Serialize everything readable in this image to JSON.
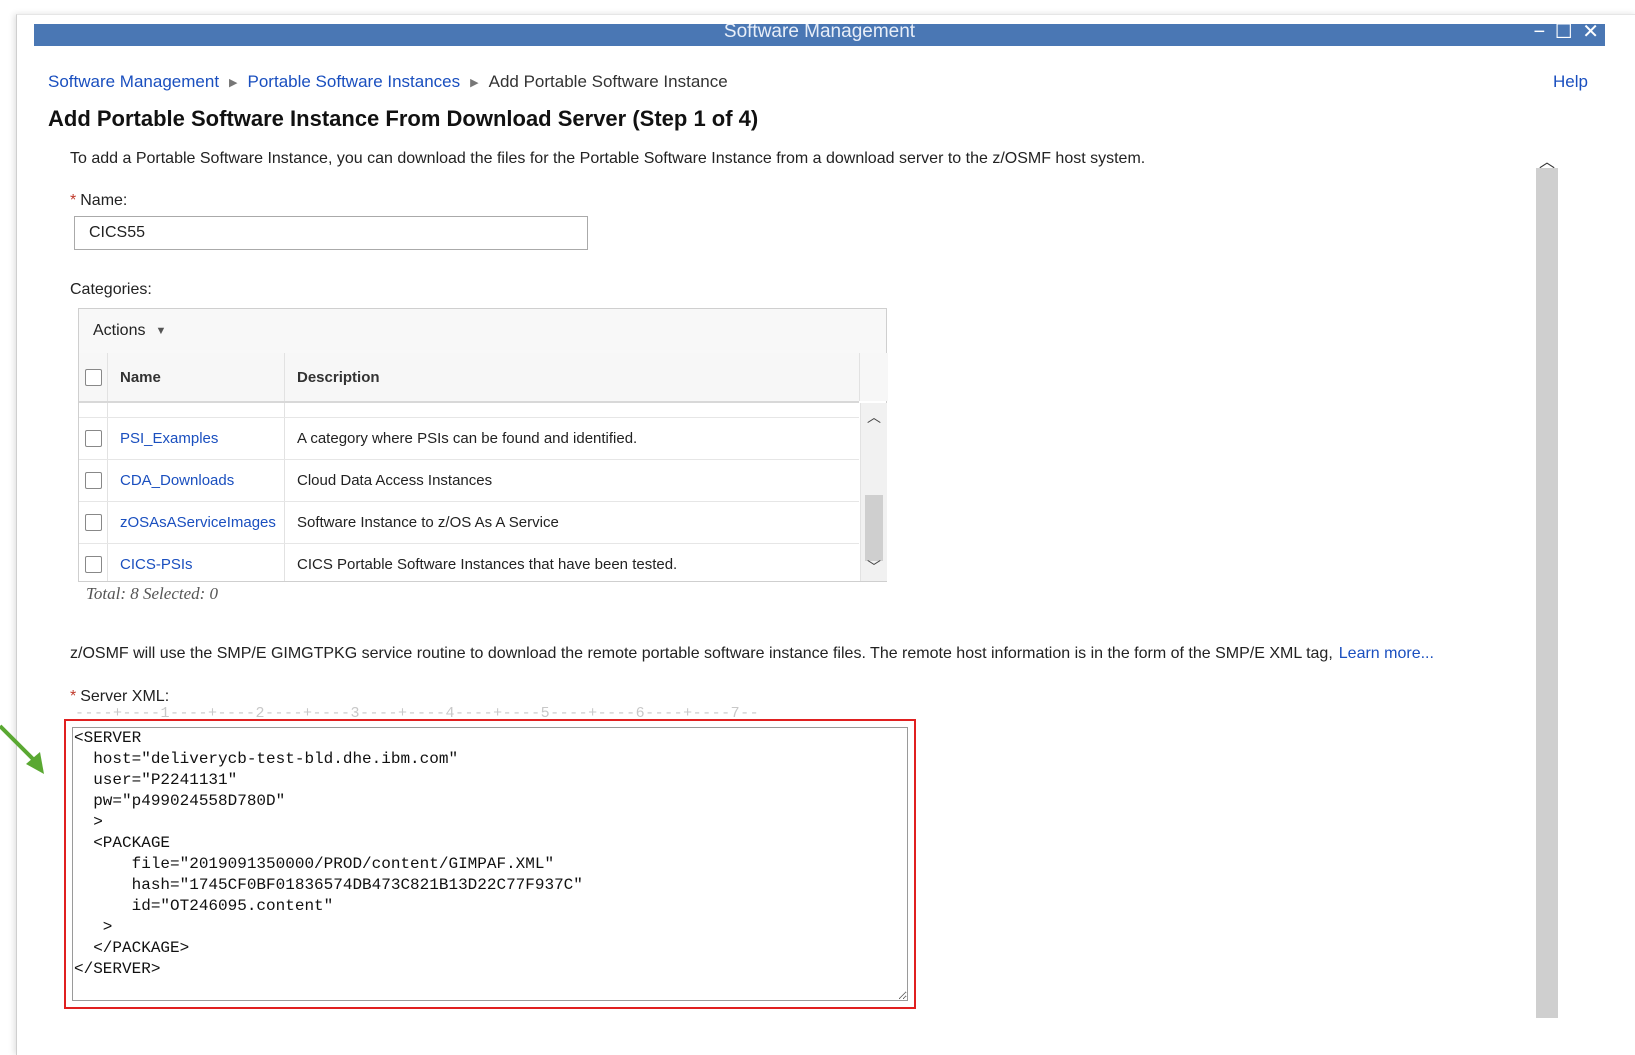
{
  "window": {
    "title": "Software Management",
    "controls": "− ☐ ✕"
  },
  "breadcrumb": {
    "items": [
      "Software Management",
      "Portable Software Instances"
    ],
    "current": "Add Portable Software Instance",
    "separator": "▶"
  },
  "help": "Help",
  "page_title": "Add Portable Software Instance From Download Server (Step 1 of 4)",
  "intro": "To add a Portable Software Instance, you can download the files for the Portable Software Instance from a download server to the z/OSMF host system.",
  "name_field": {
    "required_mark": "*",
    "label": "Name:",
    "value": "CICS55"
  },
  "categories": {
    "label": "Categories:",
    "actions_label": "Actions",
    "columns": [
      "Name",
      "Description"
    ],
    "rows": [
      {
        "name": "PSI_Examples",
        "description": "A category where PSIs can be found and identified."
      },
      {
        "name": "CDA_Downloads",
        "description": "Cloud Data Access Instances"
      },
      {
        "name": "zOSAsAServiceImages",
        "description": "Software Instance to z/OS As A Service"
      },
      {
        "name": "CICS-PSIs",
        "description": "CICS Portable Software Instances that have been tested."
      }
    ],
    "totals": "Total: 8 Selected: 0"
  },
  "gimgtpkg_text": "z/OSMF will use the SMP/E GIMGTPKG service routine to download the remote portable software instance files. The remote host information is in the form of the SMP/E XML tag,",
  "learn_more": "Learn more...",
  "server_xml": {
    "required_mark": "*",
    "label": "Server XML:",
    "ruler": "----+----1----+----2----+----3----+----4----+----5----+----6----+----7--",
    "value": "<SERVER\n  host=\"deliverycb-test-bld.dhe.ibm.com\"\n  user=\"P2241131\"\n  pw=\"p499024558D780D\"\n  >\n  <PACKAGE\n      file=\"2019091350000/PROD/content/GIMPAF.XML\"\n      hash=\"1745CF0BF01836574DB473C821B13D22C77F937C\"\n      id=\"OT246095.content\"\n   >\n  </PACKAGE>\n</SERVER>"
  },
  "colors": {
    "titlebar": "#4a77b4",
    "link": "#1a4fbf",
    "highlight": "#e02020",
    "arrow": "#5aa832"
  }
}
